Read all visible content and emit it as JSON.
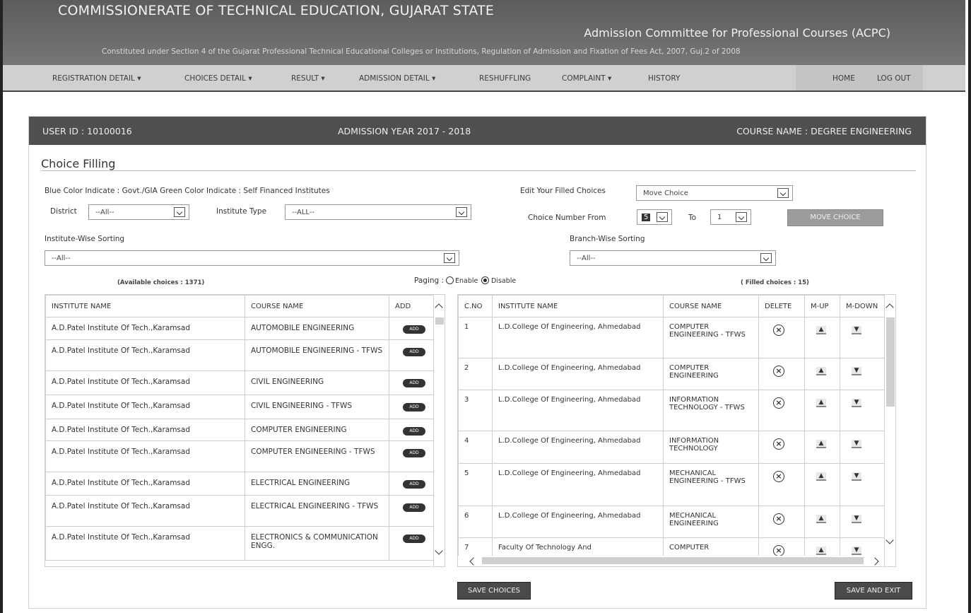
{
  "header": {
    "title": "COMMISSIONERATE OF TECHNICAL EDUCATION, GUJARAT STATE",
    "subtitle": "Admission Committee for Professional Courses (ACPC)",
    "act": "Constituted under Section 4 of the Gujarat Professional Technical Educational Colleges or Institutions, Regulation of Admission and Fixation of Fees Act, 2007, Guj.2 of 2008"
  },
  "nav": {
    "items": [
      "REGISTRATION DETAIL ▾",
      "CHOICES DETAIL ▾",
      "RESULT ▾",
      "ADMISSION DETAIL ▾",
      "RESHUFFLING",
      "COMPLAINT ▾",
      "HISTORY"
    ],
    "home": "HOME",
    "logout": "LOG OUT"
  },
  "panel": {
    "user_id": "USER ID : 10100016",
    "year": "ADMISSION YEAR 2017 - 2018",
    "course": "COURSE NAME : DEGREE ENGINEERING"
  },
  "choice": {
    "title": "Choice Filling",
    "legend": "Blue Color Indicate : Govt./GIA Green Color Indicate : Self Financed Institutes",
    "district_label": "District",
    "district_value": "--All--",
    "inst_type_label": "Institute Type",
    "inst_type_value": "--ALL--",
    "edit_label": "Edit Your Filled Choices",
    "edit_value": "Move Choice",
    "from_label": "Choice Number From",
    "from_value": "5",
    "to_label": "To",
    "to_value": "1",
    "move_button": "MOVE CHOICE",
    "inst_sort_label": "Institute-Wise Sorting",
    "inst_sort_value": "--All--",
    "branch_sort_label": "Branch-Wise Sorting",
    "branch_sort_value": "--All--",
    "available": "(Available choices : 1371)",
    "paging_label": "Paging :",
    "enable": "Enable",
    "disable": "Disable",
    "filled": "( Filled choices : 15)"
  },
  "left_table": {
    "headers": [
      "INSTITUTE NAME",
      "COURSE NAME",
      "ADD"
    ],
    "add_label": "ADD",
    "rows": [
      [
        "A.D.Patel Institute Of Tech.,Karamsad",
        "AUTOMOBILE ENGINEERING"
      ],
      [
        "A.D.Patel Institute Of Tech.,Karamsad",
        "AUTOMOBILE ENGINEERING - TFWS"
      ],
      [
        "A.D.Patel Institute Of Tech.,Karamsad",
        "CIVIL ENGINEERING"
      ],
      [
        "A.D.Patel Institute Of Tech.,Karamsad",
        "CIVIL ENGINEERING - TFWS"
      ],
      [
        "A.D.Patel Institute Of Tech.,Karamsad",
        "COMPUTER ENGINEERING"
      ],
      [
        "A.D.Patel Institute Of Tech.,Karamsad",
        "COMPUTER ENGINEERING - TFWS"
      ],
      [
        "A.D.Patel Institute Of Tech.,Karamsad",
        "ELECTRICAL ENGINEERING"
      ],
      [
        "A.D.Patel Institute Of Tech.,Karamsad",
        "ELECTRICAL ENGINEERING - TFWS"
      ],
      [
        "A.D.Patel Institute Of Tech.,Karamsad",
        "ELECTRONICS & COMMUNICATION ENGG."
      ]
    ]
  },
  "right_table": {
    "headers": [
      "C.NO",
      "INSTITUTE NAME",
      "COURSE NAME",
      "DELETE",
      "M-UP",
      "M-DOWN"
    ],
    "rows": [
      [
        "1",
        "L.D.College Of Engineering, Ahmedabad",
        "COMPUTER ENGINEERING - TFWS"
      ],
      [
        "2",
        "L.D.College Of Engineering, Ahmedabad",
        "COMPUTER ENGINEERING"
      ],
      [
        "3",
        "L.D.College Of Engineering, Ahmedabad",
        "INFORMATION TECHNOLOGY - TFWS"
      ],
      [
        "4",
        "L.D.College Of Engineering, Ahmedabad",
        "INFORMATION TECHNOLOGY"
      ],
      [
        "5",
        "L.D.College Of Engineering, Ahmedabad",
        "MECHANICAL ENGINEERING - TFWS"
      ],
      [
        "6",
        "L.D.College Of Engineering, Ahmedabad",
        "MECHANICAL ENGINEERING"
      ],
      [
        "7",
        "Faculty Of Technology And",
        "COMPUTER"
      ]
    ]
  },
  "buttons": {
    "save": "SAVE CHOICES",
    "save_exit": "SAVE AND EXIT"
  }
}
